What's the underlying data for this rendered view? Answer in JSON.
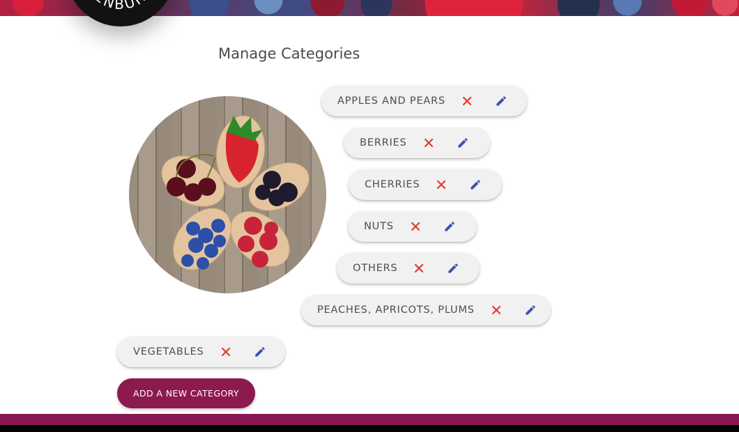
{
  "logo": {
    "text": "ENBUR"
  },
  "page": {
    "title": "Manage Categories"
  },
  "colors": {
    "accent": "#8d1a4f",
    "remove_icon": "#e53935",
    "edit_icon": "#3f51b5",
    "chip_bg": "#f1f1f1"
  },
  "categories": [
    {
      "label": "APPLES AND PEARS",
      "remove_icon": "close-icon",
      "edit_icon": "pencil-icon"
    },
    {
      "label": "BERRIES",
      "remove_icon": "close-icon",
      "edit_icon": "pencil-icon"
    },
    {
      "label": "CHERRIES",
      "remove_icon": "close-icon",
      "edit_icon": "pencil-icon"
    },
    {
      "label": "NUTS",
      "remove_icon": "close-icon",
      "edit_icon": "pencil-icon"
    },
    {
      "label": "OTHERS",
      "remove_icon": "close-icon",
      "edit_icon": "pencil-icon"
    },
    {
      "label": "PEACHES, APRICOTS, PLUMS",
      "remove_icon": "close-icon",
      "edit_icon": "pencil-icon"
    },
    {
      "label": "VEGETABLES",
      "remove_icon": "close-icon",
      "edit_icon": "pencil-icon"
    }
  ],
  "actions": {
    "add_label": "ADD A NEW CATEGORY"
  }
}
